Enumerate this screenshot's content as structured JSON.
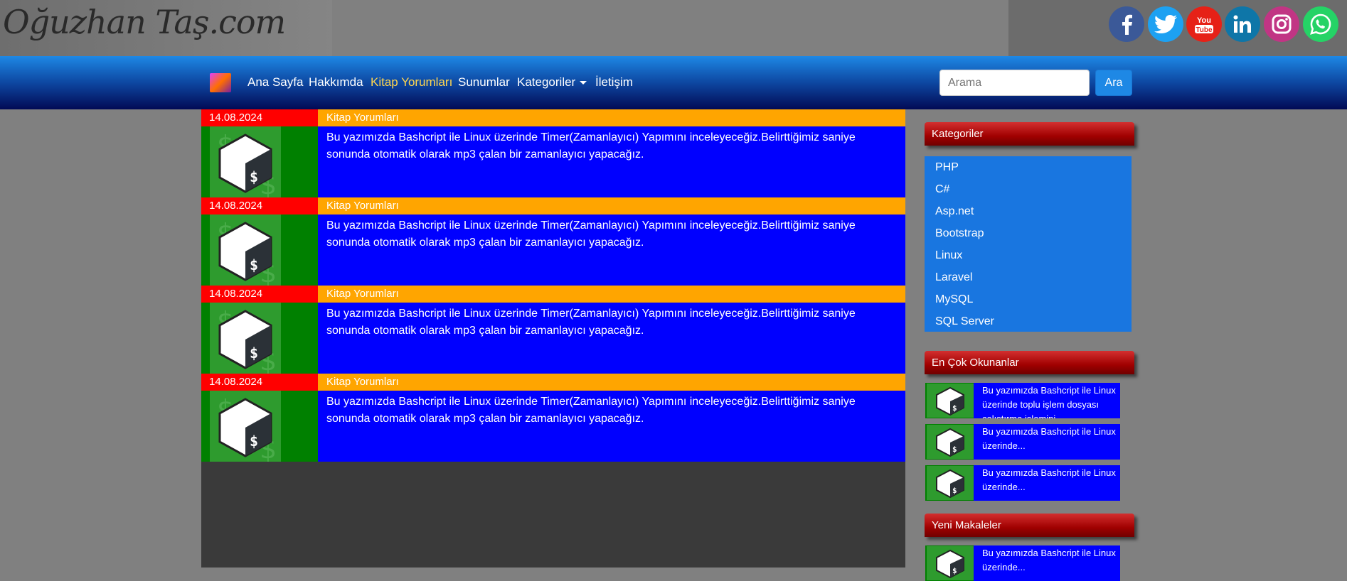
{
  "site": {
    "logo_text": "Oğuzhan Taş.com"
  },
  "social": [
    {
      "name": "facebook",
      "color": "#3b5998",
      "glyph": "f"
    },
    {
      "name": "twitter",
      "color": "#1da1f2",
      "glyph": "t"
    },
    {
      "name": "youtube",
      "color": "#e62117",
      "glyph": "You Tube"
    },
    {
      "name": "linkedin",
      "color": "#0e76a8",
      "glyph": "in"
    },
    {
      "name": "instagram",
      "color": "#c13584",
      "glyph": "ig"
    },
    {
      "name": "whatsapp",
      "color": "#25d366",
      "glyph": "wa"
    }
  ],
  "nav": {
    "items": [
      "Ana Sayfa",
      "Hakkımda",
      "Kitap Yorumları",
      "Sunumlar",
      "Kategoriler",
      "İletişim"
    ],
    "active": "Kitap Yorumları",
    "search_placeholder": "Arama",
    "search_button": "Ara"
  },
  "posts": [
    {
      "date": "14.08.2024",
      "category": "Kitap Yorumları",
      "text": "Bu yazımızda Bashcript ile Linux üzerinde Timer(Zamanlayıcı) Yapımını inceleyeceğiz.Belirttiğimiz saniye sonunda otomatik olarak mp3 çalan bir zamanlayıcı yapacağız."
    },
    {
      "date": "14.08.2024",
      "category": "Kitap Yorumları",
      "text": "Bu yazımızda Bashcript ile Linux üzerinde Timer(Zamanlayıcı) Yapımını inceleyeceğiz.Belirttiğimiz saniye sonunda otomatik olarak mp3 çalan bir zamanlayıcı yapacağız."
    },
    {
      "date": "14.08.2024",
      "category": "Kitap Yorumları",
      "text": "Bu yazımızda Bashcript ile Linux üzerinde Timer(Zamanlayıcı) Yapımını inceleyeceğiz.Belirttiğimiz saniye sonunda otomatik olarak mp3 çalan bir zamanlayıcı yapacağız."
    },
    {
      "date": "14.08.2024",
      "category": "Kitap Yorumları",
      "text": "Bu yazımızda Bashcript ile Linux üzerinde Timer(Zamanlayıcı) Yapımını inceleyeceğiz.Belirttiğimiz saniye sonunda otomatik olarak mp3 çalan bir zamanlayıcı yapacağız."
    }
  ],
  "sidebar": {
    "categories_title": "Kategoriler",
    "categories": [
      "PHP",
      "C#",
      "Asp.net",
      "Bootstrap",
      "Linux",
      "Laravel",
      "MySQL",
      "SQL Server"
    ],
    "popular_title": "En Çok Okunanlar",
    "popular": [
      {
        "text": "Bu yazımızda Bashcript ile Linux üzerinde toplu işlem dosyası çalıştırma işlemini"
      },
      {
        "text": "Bu yazımızda Bashcript ile Linux üzerinde..."
      },
      {
        "text": "Bu yazımızda Bashcript ile Linux üzerinde..."
      }
    ],
    "new_title": "Yeni Makaleler",
    "new": [
      {
        "text": "Bu yazımızda Bashcript ile Linux üzerinde..."
      }
    ]
  }
}
